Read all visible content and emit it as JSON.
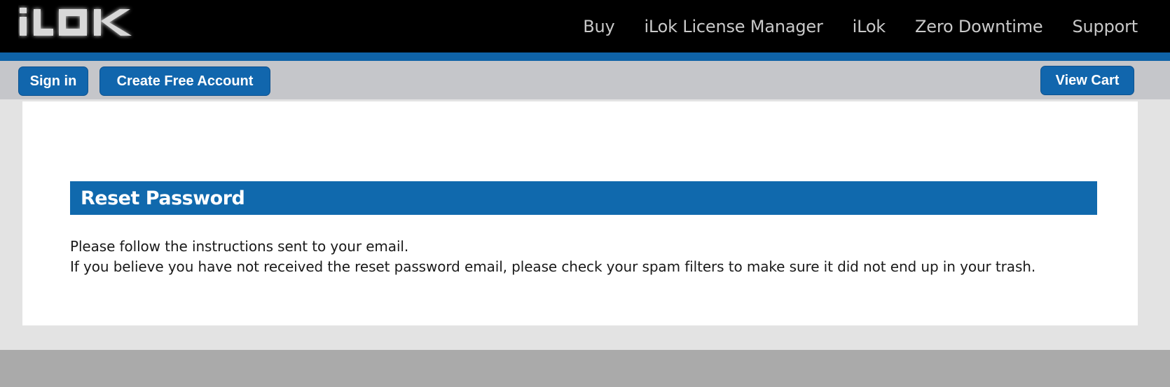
{
  "header": {
    "logo_text": "iLOK",
    "nav": [
      {
        "label": "Buy"
      },
      {
        "label": "iLok License Manager"
      },
      {
        "label": "iLok"
      },
      {
        "label": "Zero Downtime"
      },
      {
        "label": "Support"
      }
    ]
  },
  "toolbar": {
    "signin_label": "Sign in",
    "create_account_label": "Create Free Account",
    "view_cart_label": "View Cart"
  },
  "main": {
    "title": "Reset Password",
    "message_line1": "Please follow the instructions sent to your email.",
    "message_line2": "If you believe you have not received the reset password email, please check your spam filters to make sure it did not end up in your trash."
  },
  "colors": {
    "brand_blue": "#1069ad",
    "topbar": "#000000",
    "subbar": "#c5c6ca"
  }
}
